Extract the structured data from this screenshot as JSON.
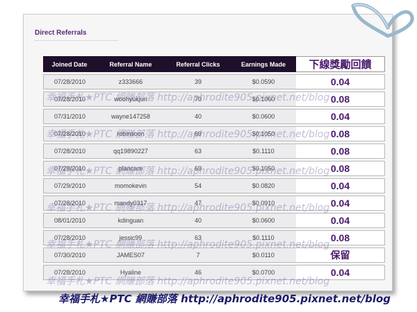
{
  "section_title": "Direct Referrals",
  "table": {
    "headers": [
      "Joined Date",
      "Referral Name",
      "Referral Clicks",
      "Earnings Made",
      "下線獎勵回饋"
    ],
    "rows": [
      {
        "date": "07/28/2010",
        "name": "z333666",
        "clicks": "39",
        "earnings": "$0.0590",
        "reward": "0.04"
      },
      {
        "date": "07/28/2010",
        "name": "woohyukjun",
        "clicks": "70",
        "earnings": "$0.1060",
        "reward": "0.08"
      },
      {
        "date": "07/31/2010",
        "name": "wayne147258",
        "clicks": "40",
        "earnings": "$0.0600",
        "reward": "0.04"
      },
      {
        "date": "07/28/2010",
        "name": "robinsoon",
        "clicks": "69",
        "earnings": "$0.1050",
        "reward": "0.08"
      },
      {
        "date": "07/28/2010",
        "name": "qq19890227",
        "clicks": "63",
        "earnings": "$0.1110",
        "reward": "0.08"
      },
      {
        "date": "07/28/2010",
        "name": "plancare",
        "clicks": "69",
        "earnings": "$0.1050",
        "reward": "0.08"
      },
      {
        "date": "07/29/2010",
        "name": "momokevin",
        "clicks": "54",
        "earnings": "$0.0820",
        "reward": "0.04"
      },
      {
        "date": "07/28/2010",
        "name": "mandy0317",
        "clicks": "47",
        "earnings": "$0.0910",
        "reward": "0.04"
      },
      {
        "date": "08/01/2010",
        "name": "kdinguan",
        "clicks": "40",
        "earnings": "$0.0600",
        "reward": "0.04"
      },
      {
        "date": "07/28/2010",
        "name": "jessic99",
        "clicks": "63",
        "earnings": "$0.1110",
        "reward": "0.08"
      },
      {
        "date": "07/30/2010",
        "name": "JAMES07",
        "clicks": "7",
        "earnings": "$0.0110",
        "reward": "保留"
      },
      {
        "date": "07/28/2010",
        "name": "Hyaline",
        "clicks": "46",
        "earnings": "$0.0700",
        "reward": "0.04"
      }
    ]
  },
  "watermark_text": "幸福手札★PTC 網賺部落 http://aphrodite905.pixnet.net/blog",
  "footer_text": "幸福手札★PTC 網賺部落 http://aphrodite905.pixnet.net/blog",
  "colors": {
    "header_bg": "#1e0f2b",
    "reward_text": "#4a1a6b",
    "title": "#5b2a7a"
  }
}
